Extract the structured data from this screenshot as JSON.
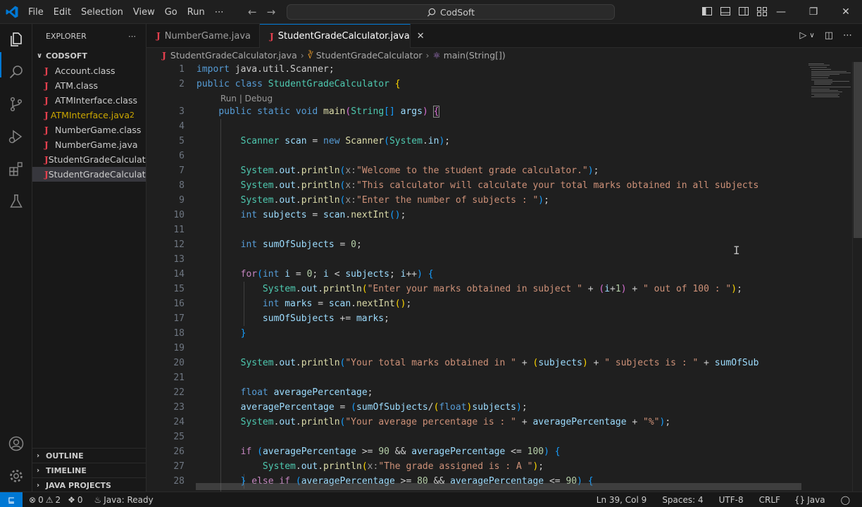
{
  "titlebar": {
    "menu": [
      "File",
      "Edit",
      "Selection",
      "View",
      "Go",
      "Run",
      "⋯"
    ],
    "search": "CodSoft"
  },
  "sidebar": {
    "header": "EXPLORER",
    "folder": "CODSOFT",
    "files": [
      {
        "name": "Account.class"
      },
      {
        "name": "ATM.class"
      },
      {
        "name": "ATMInterface.class"
      },
      {
        "name": "ATMInterface.java",
        "badge": "2"
      },
      {
        "name": "NumberGame.class"
      },
      {
        "name": "NumberGame.java"
      },
      {
        "name": "StudentGradeCalculat..."
      },
      {
        "name": "StudentGradeCalculat..."
      }
    ],
    "sections": [
      "OUTLINE",
      "TIMELINE",
      "JAVA PROJECTS"
    ]
  },
  "tabs": [
    {
      "label": "NumberGame.java"
    },
    {
      "label": "StudentGradeCalculator.java"
    }
  ],
  "breadcrumb": {
    "file": "StudentGradeCalculator.java",
    "class": "StudentGradeCalculator",
    "method": "main(String[])"
  },
  "editor": {
    "codelens": "Run | Debug",
    "line_numbers": [
      "1",
      "2",
      "3",
      "4",
      "5",
      "6",
      "7",
      "8",
      "9",
      "10",
      "11",
      "12",
      "13",
      "14",
      "15",
      "16",
      "17",
      "18",
      "19",
      "20",
      "21",
      "22",
      "23",
      "24",
      "25",
      "26",
      "27",
      "28"
    ]
  },
  "statusbar": {
    "errors": "0",
    "warnings": "2",
    "ports": "0",
    "java": "Java: Ready",
    "position": "Ln 39, Col 9",
    "spaces": "Spaces: 4",
    "encoding": "UTF-8",
    "eol": "CRLF",
    "language": "Java"
  },
  "colors": {
    "accent": "#0078d4",
    "keyword": "#569cd6",
    "control": "#c586c0",
    "type": "#4ec9b0",
    "function": "#dcdcaa",
    "string": "#ce9178",
    "warning": "#cca700",
    "java_icon": "#e5404e"
  },
  "icons": [
    "vscode-logo-icon",
    "files-icon",
    "search-icon",
    "source-control-icon",
    "run-debug-icon",
    "extensions-icon",
    "testing-icon",
    "account-icon",
    "manage-gear-icon"
  ]
}
